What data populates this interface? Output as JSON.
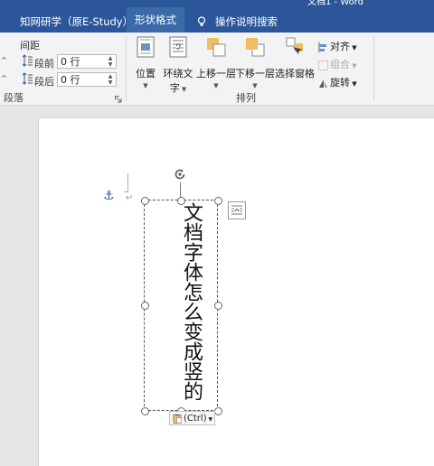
{
  "window": {
    "title": "文档1 - Word"
  },
  "tabs": {
    "cnki": "知网研学（原E-Study）",
    "shape_format": "形状格式",
    "help_search": "操作说明搜索"
  },
  "paragraph": {
    "spacing_title": "间距",
    "before_label": "段前",
    "before_value": "0 行",
    "after_label": "段后",
    "after_value": "0 行",
    "group_label": "段落"
  },
  "arrange": {
    "position": "位置",
    "wrap_text_line1": "环绕文",
    "wrap_text_line2": "字",
    "bring_forward": "上移一层",
    "send_backward": "下移一层",
    "selection_pane": "选择窗格",
    "align": "对齐",
    "group": "组合",
    "rotate": "旋转",
    "group_label": "排列"
  },
  "document": {
    "textbox_text": "文档字体怎么变成竖的",
    "paste_label": "(Ctrl)"
  }
}
